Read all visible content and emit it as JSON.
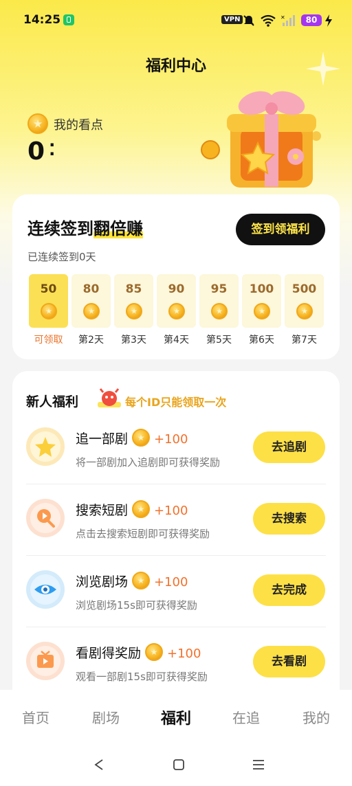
{
  "status_bar": {
    "time": "14:25",
    "vpn": "VPN",
    "battery": "80"
  },
  "header": {
    "title": "福利中心"
  },
  "points": {
    "label": "我的看点",
    "value": "0"
  },
  "signin": {
    "title_part1": "连续签到",
    "title_part2": "翻倍赚",
    "button": "签到领福利",
    "subtitle": "已连续签到0天",
    "days": [
      {
        "points": "50",
        "label": "可领取",
        "active": true
      },
      {
        "points": "80",
        "label": "第2天"
      },
      {
        "points": "85",
        "label": "第3天"
      },
      {
        "points": "90",
        "label": "第4天"
      },
      {
        "points": "95",
        "label": "第5天"
      },
      {
        "points": "100",
        "label": "第6天"
      },
      {
        "points": "500",
        "label": "第7天"
      }
    ]
  },
  "newcomer": {
    "title": "新人福利",
    "note": "每个ID只能领取一次",
    "tasks": [
      {
        "name": "追一部剧",
        "reward": "+100",
        "desc": "将一部剧加入追剧即可获得奖励",
        "button": "去追剧",
        "icon": "star-icon"
      },
      {
        "name": "搜索短剧",
        "reward": "+100",
        "desc": "点击去搜索短剧即可获得奖励",
        "button": "去搜索",
        "icon": "search-icon"
      },
      {
        "name": "浏览剧场",
        "reward": "+100",
        "desc": "浏览剧场15s即可获得奖励",
        "button": "去完成",
        "icon": "eye-icon"
      },
      {
        "name": "看剧得奖励",
        "reward": "+100",
        "desc": "观看一部剧15s即可获得奖励",
        "button": "去看剧",
        "icon": "tv-icon"
      }
    ]
  },
  "tabs": [
    {
      "label": "首页"
    },
    {
      "label": "剧场"
    },
    {
      "label": "福利",
      "active": true
    },
    {
      "label": "在追"
    },
    {
      "label": "我的"
    }
  ],
  "colors": {
    "accent": "#fde046",
    "reward": "#f2712b",
    "dark": "#111111"
  }
}
